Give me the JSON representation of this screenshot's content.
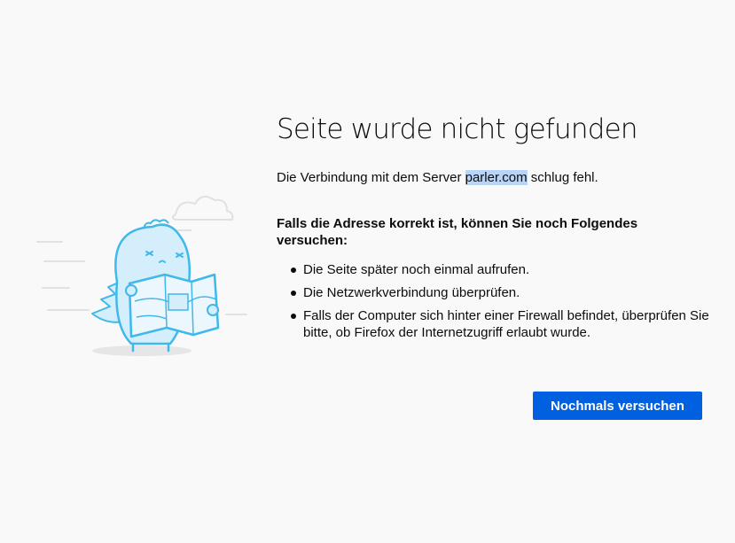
{
  "error": {
    "title": "Seite wurde nicht gefunden",
    "description_before": "Die Verbindung mit dem Server ",
    "host": "parler.com",
    "description_after": " schlug fehl.",
    "suggestion_heading": "Falls die Adresse korrekt ist, können Sie noch Folgendes versuchen:",
    "suggestions": [
      "Die Seite später noch einmal aufrufen.",
      "Die Netzwerkverbindung überprüfen.",
      "Falls der Computer sich hinter einer Firewall befindet, überprüfen Sie bitte, ob Firefox der Internetzugriff erlaubt wurde."
    ]
  },
  "actions": {
    "retry_label": "Nochmals versuchen"
  },
  "illustration": {
    "icon": "lost-dino-with-map-icon"
  },
  "colors": {
    "background": "#f9f9fa",
    "accent": "#0060df",
    "highlight": "#b8d5f8",
    "illustration": "#3fb8ea"
  }
}
